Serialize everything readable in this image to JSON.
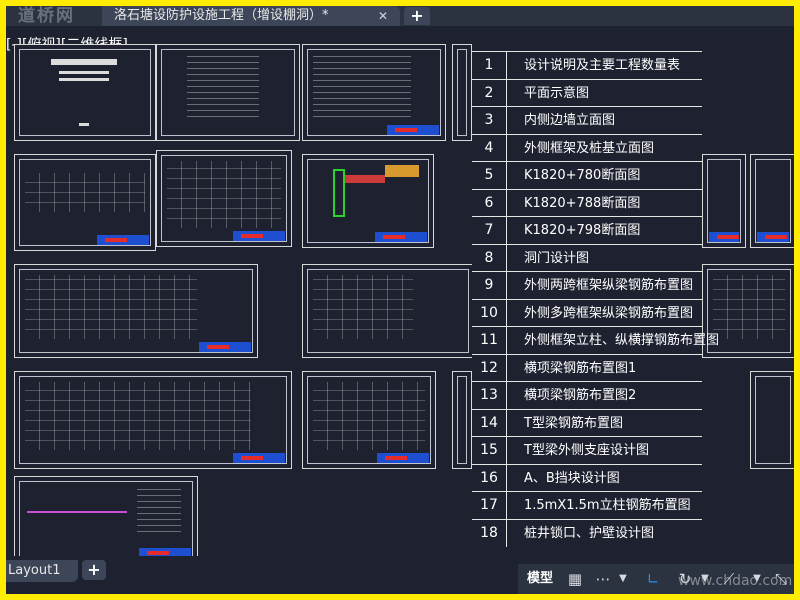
{
  "titlebar": {
    "watermark": "道桥网",
    "document_title": "洛石塘设防护设施工程（增设棚洞）*",
    "close_icon": "close-icon",
    "add_tab": "+"
  },
  "view_label": "[-][俯视][二维线框]",
  "sheet_list": {
    "rows": [
      {
        "num": "1",
        "name": "设计说明及主要工程数量表"
      },
      {
        "num": "2",
        "name": "平面示意图"
      },
      {
        "num": "3",
        "name": "内侧边墙立面图"
      },
      {
        "num": "4",
        "name": "外侧框架及桩基立面图"
      },
      {
        "num": "5",
        "name": "K1820+780断面图"
      },
      {
        "num": "6",
        "name": "K1820+788断面图"
      },
      {
        "num": "7",
        "name": "K1820+798断面图"
      },
      {
        "num": "8",
        "name": "洞门设计图"
      },
      {
        "num": "9",
        "name": "外侧两跨框架纵梁钢筋布置图"
      },
      {
        "num": "10",
        "name": "外侧多跨框架纵梁钢筋布置图"
      },
      {
        "num": "11",
        "name": "外侧框架立柱、纵横撑钢筋布置图"
      },
      {
        "num": "12",
        "name": "横项梁钢筋布置图1"
      },
      {
        "num": "13",
        "name": "横项梁钢筋布置图2"
      },
      {
        "num": "14",
        "name": "T型梁钢筋布置图"
      },
      {
        "num": "15",
        "name": "T型梁外侧支座设计图"
      },
      {
        "num": "16",
        "name": "A、B挡块设计图"
      },
      {
        "num": "17",
        "name": "1.5mX1.5m立柱钢筋布置图"
      },
      {
        "num": "18",
        "name": "桩井锁口、护壁设计图"
      }
    ]
  },
  "layout_tabs": {
    "active": "Layout1",
    "add": "+"
  },
  "statusbar": {
    "model_label": "模型",
    "icons": [
      "grid-icon",
      "snap-grid-icon",
      "dropdown-icon",
      "ortho-icon",
      "polar-tracking-icon",
      "dropdown-icon",
      "object-snap-icon",
      "dropdown-icon",
      "annotation-scale-icon"
    ]
  },
  "watermark_br": "www.chdao.com",
  "colors": {
    "frame_border": "#ffec00",
    "canvas": "#1e2230",
    "title_stamp_blue": "#1d4fd0",
    "title_stamp_red": "#e52b2b"
  }
}
